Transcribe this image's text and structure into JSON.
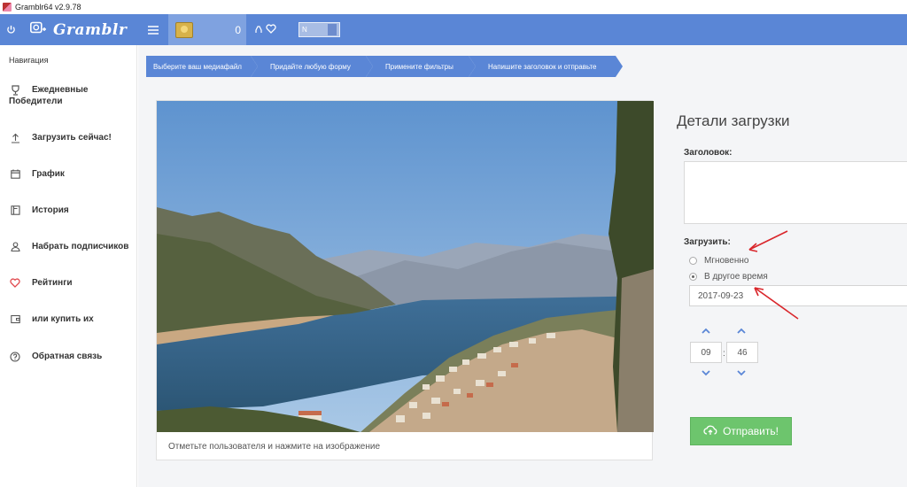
{
  "window": {
    "title": "Gramblr64 v2.9.78"
  },
  "topbar": {
    "brand": "Gramblr",
    "coins": "0",
    "toggle_on": "N",
    "toggle_off": "",
    "accent": "#5a86d6"
  },
  "sidebar": {
    "title": "Навигация",
    "items": [
      {
        "icon": "trophy-icon",
        "line1": "Ежедневные",
        "line2": "Победители"
      },
      {
        "icon": "upload-icon",
        "label": "Загрузить сейчас!"
      },
      {
        "icon": "calendar-icon",
        "label": "График"
      },
      {
        "icon": "book-icon",
        "label": "История"
      },
      {
        "icon": "user-icon",
        "label": "Набрать подписчиков"
      },
      {
        "icon": "heart-icon",
        "label": "Рейтинги"
      },
      {
        "icon": "wallet-icon",
        "label": "или купить их"
      },
      {
        "icon": "help-icon",
        "label": "Обратная связь"
      }
    ]
  },
  "steps": [
    "Выберите ваш медиафайл",
    "Придайте любую форму",
    "Примените фильтры",
    "Напишите заголовок и отправьте"
  ],
  "image": {
    "caption": "Отметьте пользователя и нажмите на изображение"
  },
  "details": {
    "title": "Детали загрузки",
    "caption_label": "Заголовок:",
    "caption_value": "",
    "upload_label": "Загрузить:",
    "option_instant": "Мгновенно",
    "option_later": "В другое время",
    "selected_option": "В другое время",
    "date": "2017-09-23",
    "hour": "09",
    "minute": "46",
    "time_separator": ":",
    "send_label": "Отправить!",
    "send_color": "#6dc56d"
  }
}
